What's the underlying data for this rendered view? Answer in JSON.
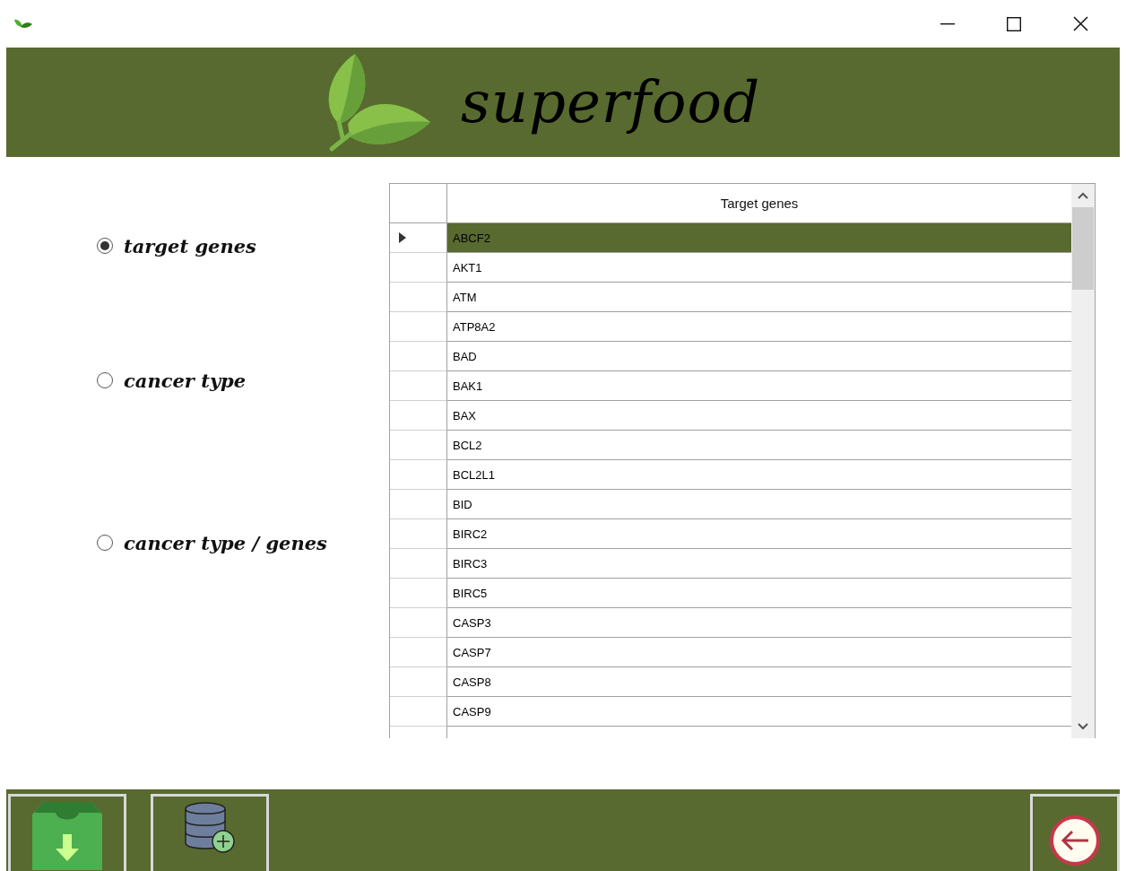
{
  "header": {
    "title": "superfood"
  },
  "options": [
    {
      "label": "target genes",
      "selected": true
    },
    {
      "label": "cancer type",
      "selected": false
    },
    {
      "label": "cancer type / genes",
      "selected": false
    }
  ],
  "table": {
    "columns": [
      "Target genes"
    ],
    "rows": [
      {
        "gene": "ABCF2",
        "selected": true
      },
      {
        "gene": "AKT1",
        "selected": false
      },
      {
        "gene": "ATM",
        "selected": false
      },
      {
        "gene": "ATP8A2",
        "selected": false
      },
      {
        "gene": "BAD",
        "selected": false
      },
      {
        "gene": "BAK1",
        "selected": false
      },
      {
        "gene": "BAX",
        "selected": false
      },
      {
        "gene": "BCL2",
        "selected": false
      },
      {
        "gene": "BCL2L1",
        "selected": false
      },
      {
        "gene": "BID",
        "selected": false
      },
      {
        "gene": "BIRC2",
        "selected": false
      },
      {
        "gene": "BIRC3",
        "selected": false
      },
      {
        "gene": "BIRC5",
        "selected": false
      },
      {
        "gene": "CASP3",
        "selected": false
      },
      {
        "gene": "CASP7",
        "selected": false
      },
      {
        "gene": "CASP8",
        "selected": false
      },
      {
        "gene": "CASP9",
        "selected": false
      }
    ]
  }
}
